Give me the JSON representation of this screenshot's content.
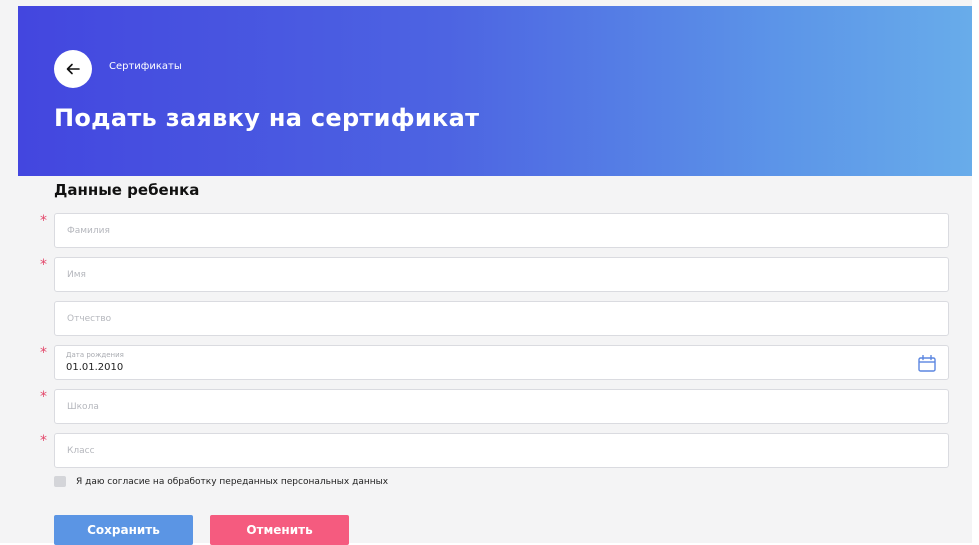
{
  "header": {
    "breadcrumb": "Сертификаты",
    "title": "Подать заявку на сертификат",
    "back_icon": "arrow-left-icon"
  },
  "form": {
    "section_title": "Данные ребенка",
    "fields": {
      "lastname": {
        "placeholder": "Фамилия",
        "required": true
      },
      "firstname": {
        "placeholder": "Имя",
        "required": true
      },
      "patronymic": {
        "placeholder": "Отчество",
        "required": false
      },
      "birthdate": {
        "label": "Дата рождения",
        "value": "01.01.2010",
        "required": true,
        "icon": "calendar-icon"
      },
      "school": {
        "placeholder": "Школа",
        "required": true
      },
      "grade": {
        "placeholder": "Класс",
        "required": true
      }
    },
    "required_mark": "*",
    "consent": {
      "label": "Я даю согласие на обработку переданных персональных данных",
      "checked": false
    },
    "buttons": {
      "save": "Сохранить",
      "cancel": "Отменить"
    }
  },
  "colors": {
    "header_gradient_start": "#4346df",
    "header_gradient_end": "#68acea",
    "save_button": "#5b95e4",
    "cancel_button": "#f55b7f",
    "required_mark": "#e3476a",
    "calendar_icon": "#5b86e0"
  }
}
